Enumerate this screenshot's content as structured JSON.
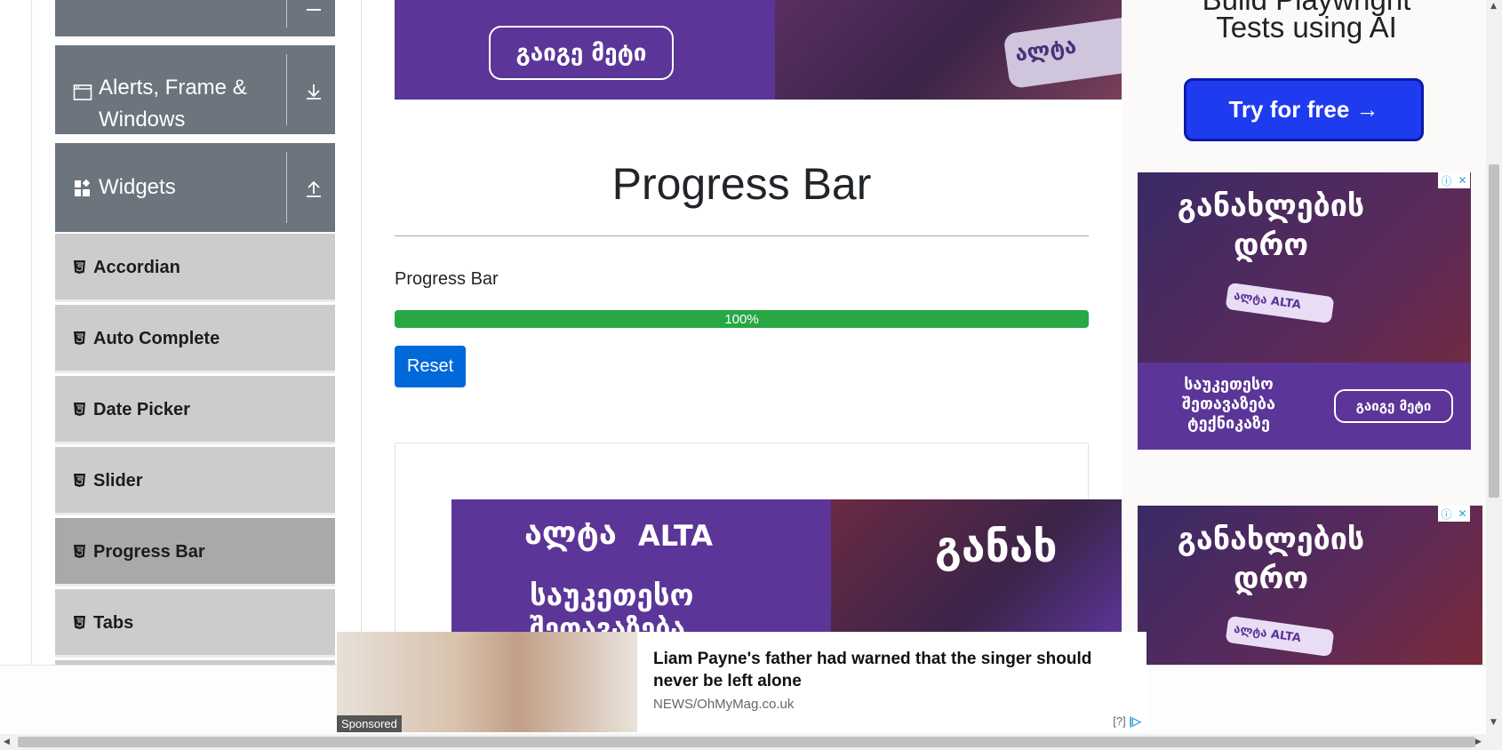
{
  "sidebar": {
    "groups": [
      {
        "label": "Alerts, Frame &",
        "label2": "Windows",
        "toggle_icon": "arrow-down-icon"
      },
      {
        "label": "Widgets",
        "toggle_icon": "arrow-up-icon"
      }
    ],
    "items": [
      {
        "label": "Accordian",
        "active": false
      },
      {
        "label": "Auto Complete",
        "active": false
      },
      {
        "label": "Date Picker",
        "active": false
      },
      {
        "label": "Slider",
        "active": false
      },
      {
        "label": "Progress Bar",
        "active": true
      },
      {
        "label": "Tabs",
        "active": false
      }
    ]
  },
  "main": {
    "title": "Progress Bar",
    "section_label": "Progress Bar",
    "progress": {
      "value": 100,
      "label": "100%"
    },
    "reset_label": "Reset"
  },
  "ads": {
    "top_banner_button": "გაიგე მეტი",
    "top_banner_brand": "ალტა",
    "bottom_banner_brand": "ალტა",
    "bottom_banner_brand2": "ALTA",
    "bottom_banner_headline": "საუკეთესო",
    "bottom_banner_headline2": "შეთავაზება",
    "bottom_banner_side": "განახ",
    "playwright_title": "Build Playwright",
    "playwright_title2": "Tests using AI",
    "playwright_button": "Try for free →",
    "side_ad_title": "განახლების",
    "side_ad_title2": "დრო",
    "side_ad_brand": "ალტა ALTA",
    "side_ad_offer": "საუკეთესო",
    "side_ad_offer2": "შეთავაზება",
    "side_ad_offer3": "ტექნიკაზე",
    "side_ad_button": "გაიგე მეტი",
    "side_ad2_title": "განახლების",
    "side_ad2_title2": "დრო",
    "side_ad2_brand": "ალტა ALTA"
  },
  "sponsored": {
    "tag": "Sponsored",
    "headline": "Liam Payne's father had warned that the singer should never be left alone",
    "source": "NEWS/OhMyMag.co.uk",
    "help": "[?]"
  },
  "colors": {
    "sidebar_header": "#6c757d",
    "menu_item": "#cccccc",
    "menu_item_active": "#a9a9a9",
    "progress_fill": "#28a745",
    "reset_button": "#0069d9",
    "ad_purple": "#5b3597",
    "try_button": "#1f3bf0"
  }
}
